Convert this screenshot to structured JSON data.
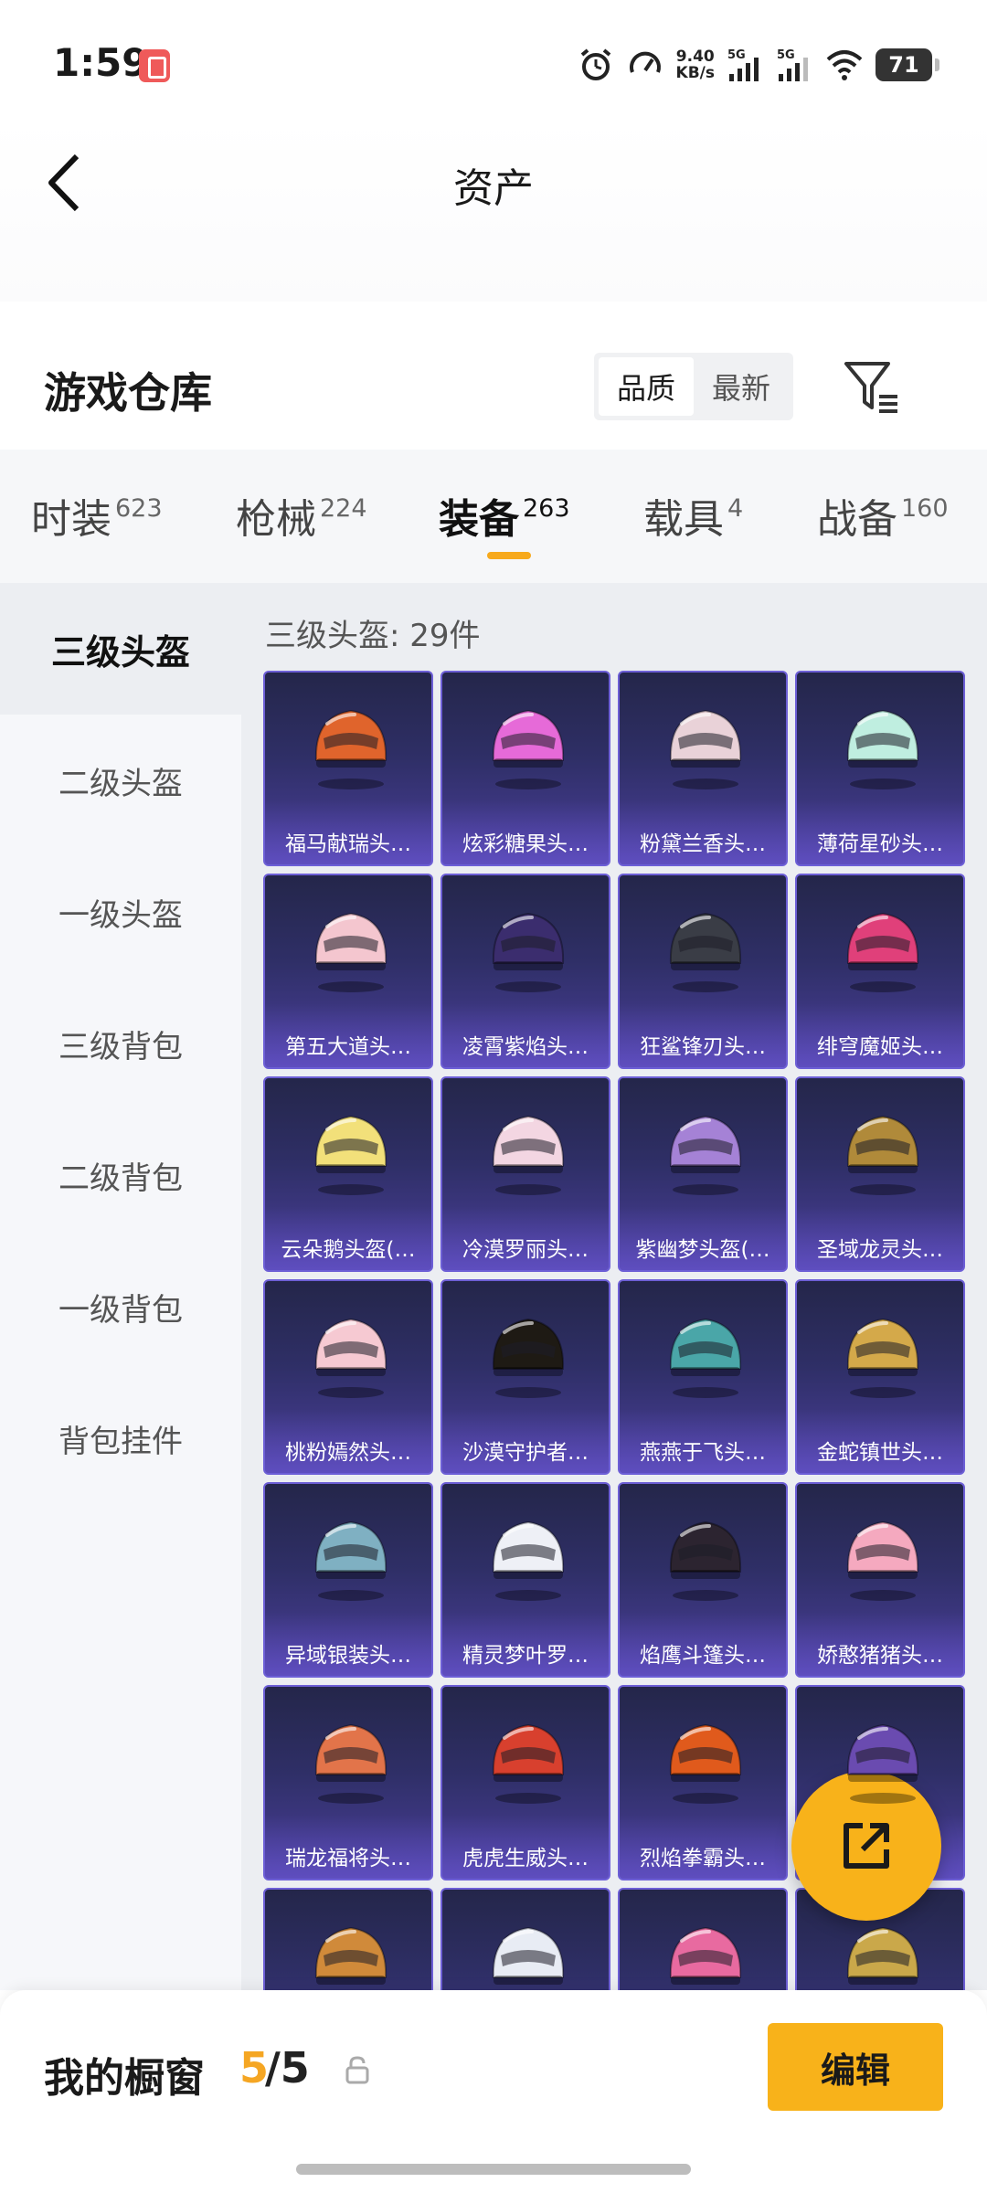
{
  "status_bar": {
    "time": "1:59",
    "net_speed_value": "9.40",
    "net_speed_unit": "KB/s",
    "sig1": "5G",
    "sig2": "5G",
    "battery": "71"
  },
  "header": {
    "title": "资产"
  },
  "warehouse": {
    "title": "游戏仓库",
    "sort_options": [
      "品质",
      "最新"
    ],
    "active_sort": 0
  },
  "tabs": [
    {
      "label": "时装",
      "count": "623"
    },
    {
      "label": "枪械",
      "count": "224"
    },
    {
      "label": "装备",
      "count": "263"
    },
    {
      "label": "载具",
      "count": "4"
    },
    {
      "label": "战备",
      "count": "160"
    }
  ],
  "active_tab": 2,
  "sidebar": {
    "items": [
      "三级头盔",
      "二级头盔",
      "一级头盔",
      "三级背包",
      "二级背包",
      "一级背包",
      "背包挂件"
    ],
    "active": 0
  },
  "content": {
    "count_label": "三级头盔: 29件",
    "items": [
      {
        "name": "福马献瑞头…",
        "color": "#e0642c"
      },
      {
        "name": "炫彩糖果头…",
        "color": "#e66ad8"
      },
      {
        "name": "粉黛兰香头…",
        "color": "#e9d2d8"
      },
      {
        "name": "薄荷星砂头…",
        "color": "#bfeee0"
      },
      {
        "name": "第五大道头…",
        "color": "#f4c6cf"
      },
      {
        "name": "凌霄紫焰头…",
        "color": "#3b2d6e"
      },
      {
        "name": "狂鲨锋刃头…",
        "color": "#3a3d46"
      },
      {
        "name": "绯穹魔姬头…",
        "color": "#e0407a"
      },
      {
        "name": "云朵鹅头盔(…",
        "color": "#f2e07a"
      },
      {
        "name": "冷漠罗丽头…",
        "color": "#f3d6e2"
      },
      {
        "name": "紫幽梦头盔(…",
        "color": "#a582d6"
      },
      {
        "name": "圣域龙灵头…",
        "color": "#b08a3a"
      },
      {
        "name": "桃粉嫣然头…",
        "color": "#f6c9d2"
      },
      {
        "name": "沙漠守护者…",
        "color": "#1e1a14"
      },
      {
        "name": "燕燕于飞头…",
        "color": "#4aa6a8"
      },
      {
        "name": "金蛇镇世头…",
        "color": "#d4a94a"
      },
      {
        "name": "异域银装头…",
        "color": "#7fb0c2"
      },
      {
        "name": "精灵梦叶罗…",
        "color": "#eef0f6"
      },
      {
        "name": "焰鹰斗篷头…",
        "color": "#2c2430"
      },
      {
        "name": "娇憨猪猪头…",
        "color": "#f5a9bf"
      },
      {
        "name": "瑞龙福将头…",
        "color": "#e2744a"
      },
      {
        "name": "虎虎生威头…",
        "color": "#d8402e"
      },
      {
        "name": "烈焰拳霸头…",
        "color": "#e05a1c"
      },
      {
        "name": "",
        "color": "#6a4bb0"
      },
      {
        "name": "",
        "color": "#d08a3a"
      },
      {
        "name": "",
        "color": "#e8ecf4"
      },
      {
        "name": "",
        "color": "#e86aa0"
      },
      {
        "name": "",
        "color": "#caa84a"
      }
    ]
  },
  "showcase": {
    "label": "我的橱窗",
    "count": "5",
    "total": "/5"
  },
  "edit_label": "编辑",
  "colors": {
    "accent": "#f8b21a",
    "card_border": "#6d5fd6"
  }
}
